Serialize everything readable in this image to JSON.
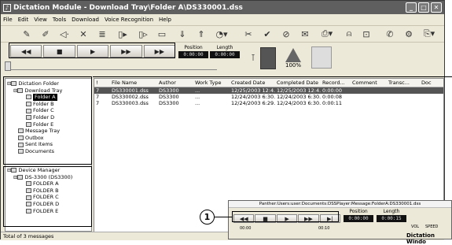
{
  "window": {
    "title": "Dictation Module - Download Tray\\Folder A\\DS330001.dss"
  },
  "menu": [
    "File",
    "Edit",
    "View",
    "Tools",
    "Download",
    "Voice Recognition",
    "Help"
  ],
  "position": {
    "label": "Position",
    "value": "0:00:00"
  },
  "length": {
    "label": "Length",
    "value": "0:00:00"
  },
  "zoom": "100%",
  "tree1": {
    "root": "Dictation Folder",
    "tray": "Download Tray",
    "folders": [
      "Folder A",
      "Folder B",
      "Folder C",
      "Folder D",
      "Folder E"
    ],
    "others": [
      "Message Tray",
      "Outbox",
      "Sent Items",
      "Documents"
    ]
  },
  "tree2": {
    "root": "Device Manager",
    "device": "DS-3300 (DS3300)",
    "folders": [
      "FOLDER A",
      "FOLDER B",
      "FOLDER C",
      "FOLDER D",
      "FOLDER E"
    ]
  },
  "columns": [
    "!",
    "File Name",
    "Author",
    "Work Type",
    "Created Date",
    "Completed Date",
    "Record...",
    "Comment",
    "Transc...",
    "Doc"
  ],
  "rows": [
    [
      "7",
      "DS330001.dss",
      "DS3300",
      "...",
      "12/25/2003 12:4...",
      "12/25/2003 12:4...",
      "0:00:00"
    ],
    [
      "7",
      "DS330002.dss",
      "DS3300",
      "...",
      "12/24/2003 6:30...",
      "12/24/2003 6:30...",
      "0:00:08"
    ],
    [
      "7",
      "DS330003.dss",
      "DS3300",
      "...",
      "12/24/2003 6:29...",
      "12/24/2003 6:30...",
      "0:00:11"
    ]
  ],
  "status": "Total of 3 messages",
  "callout": "1",
  "popup": {
    "title": "Panther:Users:user:Documents:DSSPlayer:Message:FolderA:DS330001.dss",
    "pos_label": "Position",
    "pos": "0:00:00",
    "len_label": "Length",
    "len": "0:00:15",
    "time_start": "00:00",
    "time_mid": "00:10",
    "vol": "VOL",
    "speed": "SPEED",
    "name": "Dictation Windo"
  }
}
